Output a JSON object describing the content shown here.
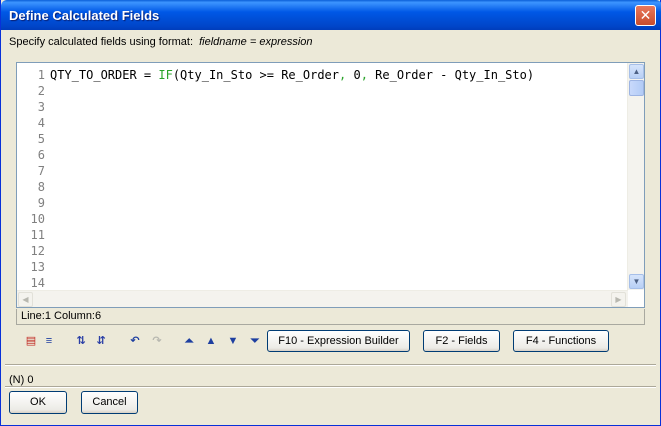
{
  "window": {
    "title": "Define Calculated Fields",
    "close_glyph": "✕"
  },
  "instruction": {
    "text": "Specify calculated fields using format:",
    "format": "fieldname = expression"
  },
  "editor": {
    "line_numbers": [
      "1",
      "2",
      "3",
      "4",
      "5",
      "6",
      "7",
      "8",
      "9",
      "10",
      "11",
      "12",
      "13",
      "14"
    ],
    "line1": {
      "lhs": "QTY_TO_ORDER = ",
      "fn": "IF",
      "open": "(Qty_In_Sto >= Re_Order",
      "comma1": ", ",
      "zero": "0",
      "comma2": ", ",
      "rest": "Re_Order - Qty_In_Sto)"
    }
  },
  "status": {
    "position": "Line:1  Column:6"
  },
  "toolbar": {
    "icons": [
      "list-icon",
      "indent-icon",
      "sort-az-icon",
      "sort-za-icon",
      "undo-icon",
      "redo-icon",
      "move-top-icon",
      "move-up-icon",
      "move-down-icon",
      "move-bottom-icon"
    ],
    "expression_builder": "F10 - Expression Builder",
    "fields": "F2 - Fields",
    "functions": "F4 - Functions"
  },
  "footer": {
    "count": "(N) 0",
    "ok": "OK",
    "cancel": "Cancel"
  }
}
